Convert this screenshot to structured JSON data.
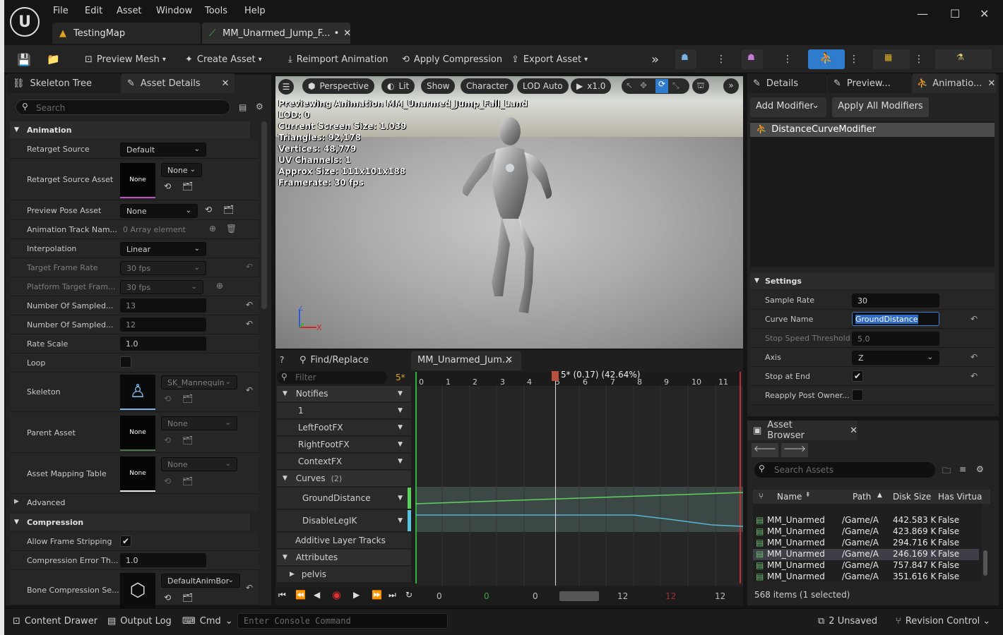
{
  "menu": [
    "File",
    "Edit",
    "Asset",
    "Window",
    "Tools",
    "Help"
  ],
  "tabs": {
    "map": "TestingMap",
    "asset": "MM_Unarmed_Jump_F...",
    "asset_mod": "•"
  },
  "toolbar": {
    "preview_mesh": "Preview Mesh",
    "create_asset": "Create Asset",
    "reimport": "Reimport Animation",
    "apply_compression": "Apply Compression",
    "export_asset": "Export Asset"
  },
  "left_panel": {
    "tabs": [
      "Skeleton Tree",
      "Asset Details"
    ],
    "search_placeholder": "Search",
    "animation_section": "Animation",
    "retarget_source": {
      "label": "Retarget Source",
      "value": "Default"
    },
    "retarget_source_asset": {
      "label": "Retarget Source Asset",
      "thumb": "None",
      "value": "None"
    },
    "preview_pose": {
      "label": "Preview Pose Asset",
      "value": "None"
    },
    "track_names": {
      "label": "Animation Track Nam...",
      "value": "0 Array element"
    },
    "interpolation": {
      "label": "Interpolation",
      "value": "Linear"
    },
    "target_frame_rate": {
      "label": "Target Frame Rate",
      "value": "30 fps"
    },
    "platform_frame_rate": {
      "label": "Platform Target Fram...",
      "value": "30 fps"
    },
    "sampled_keys": {
      "label": "Number Of Sampled...",
      "value": "13"
    },
    "sampled_frames": {
      "label": "Number Of Sampled...",
      "value": "12"
    },
    "rate_scale": {
      "label": "Rate Scale",
      "value": "1.0"
    },
    "loop": {
      "label": "Loop"
    },
    "skeleton": {
      "label": "Skeleton",
      "value": "SK_Mannequin"
    },
    "parent_asset": {
      "label": "Parent Asset",
      "thumb": "None",
      "value": "None"
    },
    "mapping_table": {
      "label": "Asset Mapping Table",
      "thumb": "None",
      "value": "None"
    },
    "advanced": "Advanced",
    "compression_section": "Compression",
    "frame_stripping": {
      "label": "Allow Frame Stripping"
    },
    "compression_error": {
      "label": "Compression Error Th...",
      "value": "1.0"
    },
    "bone_compression": {
      "label": "Bone Compression Se...",
      "value": "DefaultAnimBor"
    }
  },
  "viewport": {
    "buttons": [
      "Perspective",
      "Lit",
      "Show",
      "Character",
      "LOD Auto",
      "x1.0"
    ],
    "overlay": [
      "Previewing Animation MM_Unarmed_Jump_Fall_Land",
      "LOD: 0",
      "Current Screen Size: 1.039",
      "Triangles: 92,178",
      "Vertices: 48,779",
      "UV Channels: 1",
      "Approx Size: 111x101x188",
      "Framerate: 30 fps"
    ],
    "axis": {
      "z": "Z",
      "x": "X"
    }
  },
  "timeline": {
    "find_replace": "Find/Replace",
    "tab": "MM_Unarmed_Jum...",
    "filter": "Filter",
    "count": "5*",
    "notifies": "Notifies",
    "tracks": [
      "1",
      "LeftFootFX",
      "RightFootFX",
      "ContextFX"
    ],
    "curves": "Curves",
    "curves_count": "(2)",
    "curve_tracks": [
      "GroundDistance",
      "DisableLegIK"
    ],
    "additive": "Additive Layer Tracks",
    "attributes": "Attributes",
    "pelvis": "pelvis",
    "playhead": "5* (0.17) (42.64%)",
    "ticks": [
      "0",
      "1",
      "2",
      "3",
      "4",
      "5",
      "6",
      "7",
      "8",
      "9",
      "10",
      "11"
    ],
    "bottom_values": [
      "0",
      "0",
      "0",
      "12",
      "12",
      "12"
    ]
  },
  "right_panel": {
    "tabs": [
      "Details",
      "Preview...",
      "Animatio..."
    ],
    "add_modifier": "Add Modifier",
    "apply_all": "Apply All Modifiers",
    "modifier": "DistanceCurveModifier",
    "settings": "Settings",
    "sample_rate": {
      "label": "Sample Rate",
      "value": "30"
    },
    "curve_name": {
      "label": "Curve Name",
      "value": "GroundDistance"
    },
    "stop_speed": {
      "label": "Stop Speed Threshold",
      "value": "5.0"
    },
    "axis": {
      "label": "Axis",
      "value": "Z"
    },
    "stop_at_end": {
      "label": "Stop at End"
    },
    "reapply": {
      "label": "Reapply Post Owner..."
    }
  },
  "asset_browser": {
    "title": "Asset Browser",
    "search_placeholder": "Search Assets",
    "columns": [
      "Name",
      "Path",
      "Disk Size",
      "Has Virtua"
    ],
    "rows": [
      {
        "name": "MM_Unarmed",
        "path": "/Game/A",
        "size": "442.583 K",
        "virt": "False"
      },
      {
        "name": "MM_Unarmed",
        "path": "/Game/A",
        "size": "423.869 K",
        "virt": "False"
      },
      {
        "name": "MM_Unarmed",
        "path": "/Game/A",
        "size": "294.716 K",
        "virt": "False"
      },
      {
        "name": "MM_Unarmed",
        "path": "/Game/A",
        "size": "246.169 K",
        "virt": "False"
      },
      {
        "name": "MM_Unarmed",
        "path": "/Game/A",
        "size": "757.847 K",
        "virt": "False"
      },
      {
        "name": "MM_Unarmed",
        "path": "/Game/A",
        "size": "351.616 K",
        "virt": "False"
      }
    ],
    "status": "568 items (1 selected)"
  },
  "status_bar": {
    "content_drawer": "Content Drawer",
    "output_log": "Output Log",
    "cmd": "Cmd",
    "console_placeholder": "Enter Console Command",
    "unsaved": "2 Unsaved",
    "revision": "Revision Control"
  }
}
